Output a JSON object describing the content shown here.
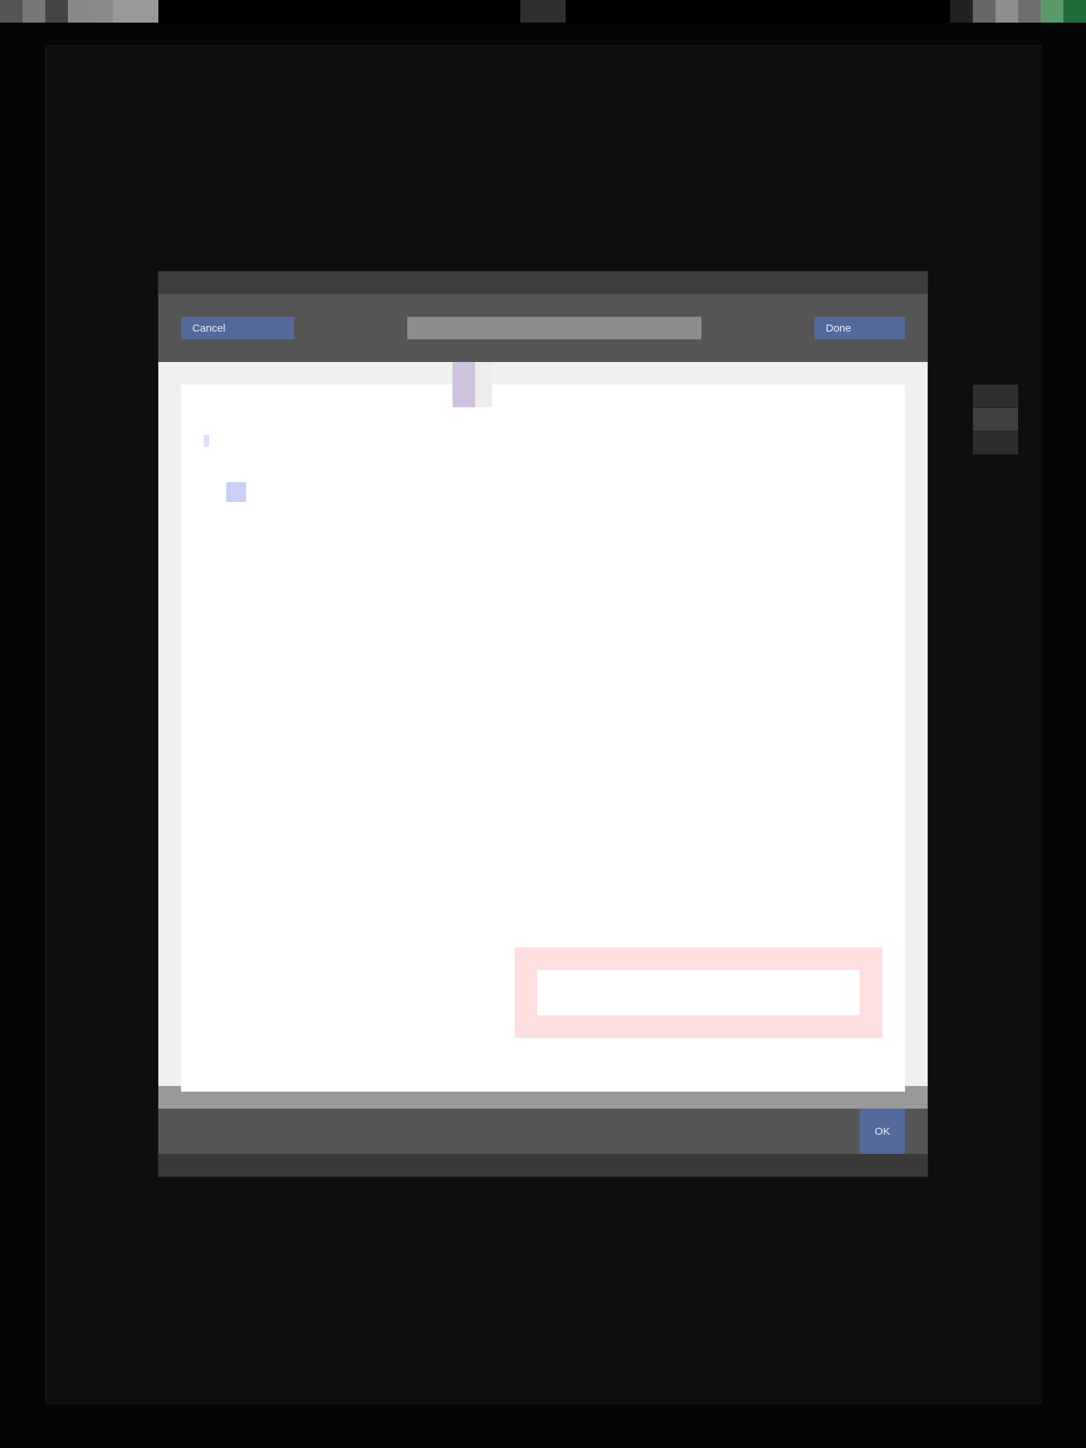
{
  "statusbar": {
    "left_icons": [
      "app-icon-1",
      "app-icon-2",
      "app-icon-3",
      "app-icon-4",
      "app-icon-5"
    ],
    "right_icons": [
      "wifi-icon",
      "signal-icon",
      "battery-icon"
    ]
  },
  "modal": {
    "cancel_label": "Cancel",
    "title": "",
    "done_label": "Done",
    "tab_label": "",
    "confirm_label": "OK"
  },
  "doc": {
    "section_title": "",
    "section_link": "",
    "checkbox_text": "",
    "checkbox_sub": "",
    "checkbox_side": "",
    "para_title": "",
    "para_lines": [],
    "para_link": "",
    "field_label": "",
    "field_placeholder": ""
  },
  "colors": {
    "accent": "#536a9a",
    "error_border": "#fddfe0",
    "checkbox": "#c9d1f6"
  }
}
